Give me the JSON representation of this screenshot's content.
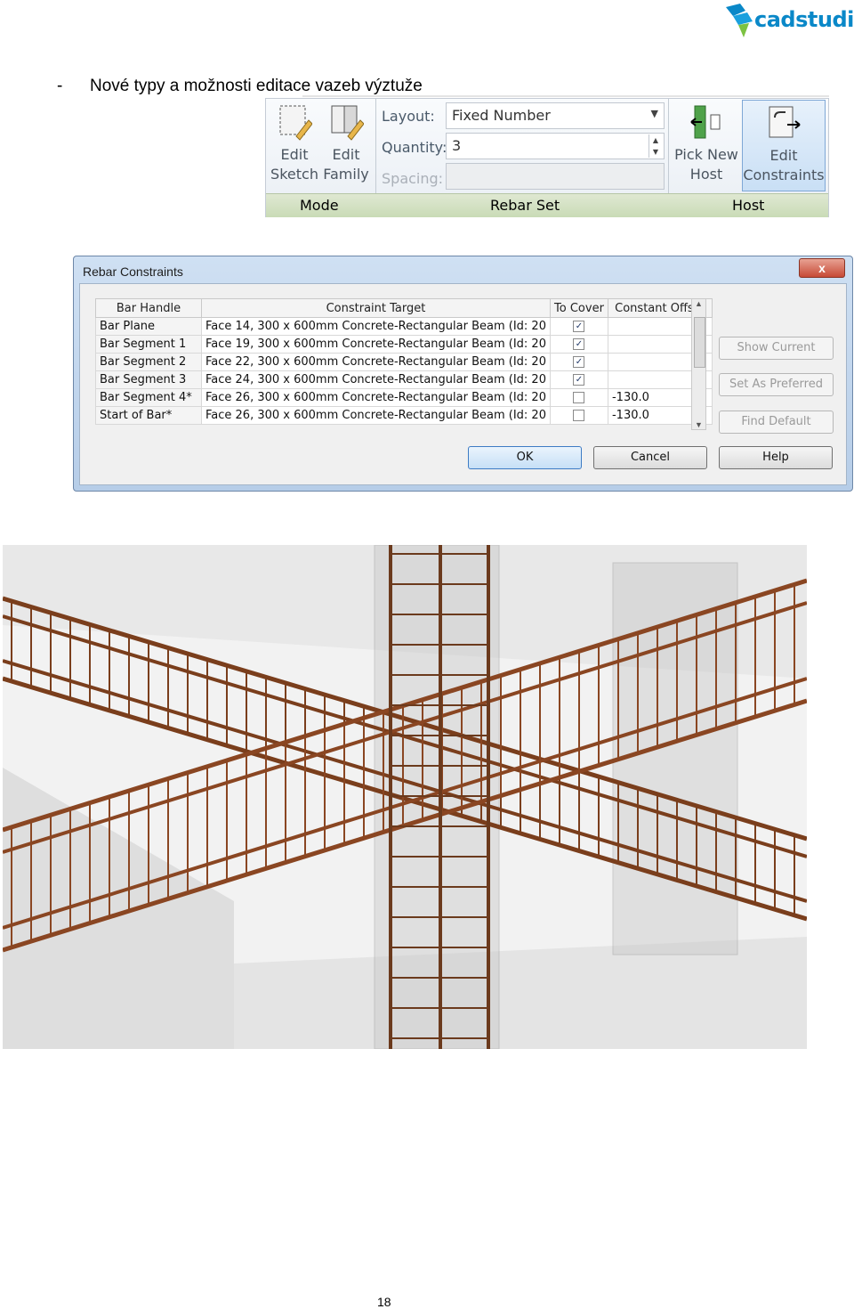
{
  "logo": {
    "brand": "cadstudio"
  },
  "heading": {
    "bullet": "-",
    "text": "Nové typy a možnosti editace vazeb výztuže"
  },
  "ribbon": {
    "mode": {
      "panel": "Mode",
      "edit_sketch": [
        "Edit",
        "Sketch"
      ],
      "edit_family": [
        "Edit",
        "Family"
      ]
    },
    "rebar_set": {
      "panel": "Rebar Set",
      "layout_label": "Layout:",
      "layout_value": "Fixed Number",
      "quantity_label": "Quantity:",
      "quantity_value": "3",
      "spacing_label": "Spacing:",
      "spacing_value": ""
    },
    "host": {
      "panel": "Host",
      "pick_new_host": [
        "Pick New",
        "Host"
      ],
      "edit_constraints": [
        "Edit",
        "Constraints"
      ]
    }
  },
  "dialog": {
    "title": "Rebar Constraints",
    "close": "x",
    "columns": [
      "Bar Handle",
      "Constraint Target",
      "To Cover",
      "Constant Offset"
    ],
    "rows": [
      {
        "handle": "Bar Plane",
        "target": "Face 14, 300 x 600mm Concrete-Rectangular Beam (Id: 20",
        "to_cover": "✓",
        "offset": ""
      },
      {
        "handle": "Bar Segment 1",
        "target": "Face 19, 300 x 600mm Concrete-Rectangular Beam (Id: 20",
        "to_cover": "✓",
        "offset": ""
      },
      {
        "handle": "Bar Segment 2",
        "target": "Face 22, 300 x 600mm Concrete-Rectangular Beam (Id: 20",
        "to_cover": "✓",
        "offset": ""
      },
      {
        "handle": "Bar Segment 3",
        "target": "Face 24, 300 x 600mm Concrete-Rectangular Beam (Id: 20",
        "to_cover": "✓",
        "offset": ""
      },
      {
        "handle": "Bar Segment 4*",
        "target": "Face 26, 300 x 600mm Concrete-Rectangular Beam (Id: 20",
        "to_cover": "",
        "offset": "-130.0"
      },
      {
        "handle": "Start of Bar*",
        "target": "Face 26, 300 x 600mm Concrete-Rectangular Beam (Id: 20",
        "to_cover": "",
        "offset": "-130.0"
      }
    ],
    "side_buttons": {
      "show_current": "Show Current",
      "set_as_preferred": "Set As Preferred",
      "find_default": "Find Default"
    },
    "buttons": {
      "ok": "OK",
      "cancel": "Cancel",
      "help": "Help"
    }
  },
  "page_number": "18"
}
